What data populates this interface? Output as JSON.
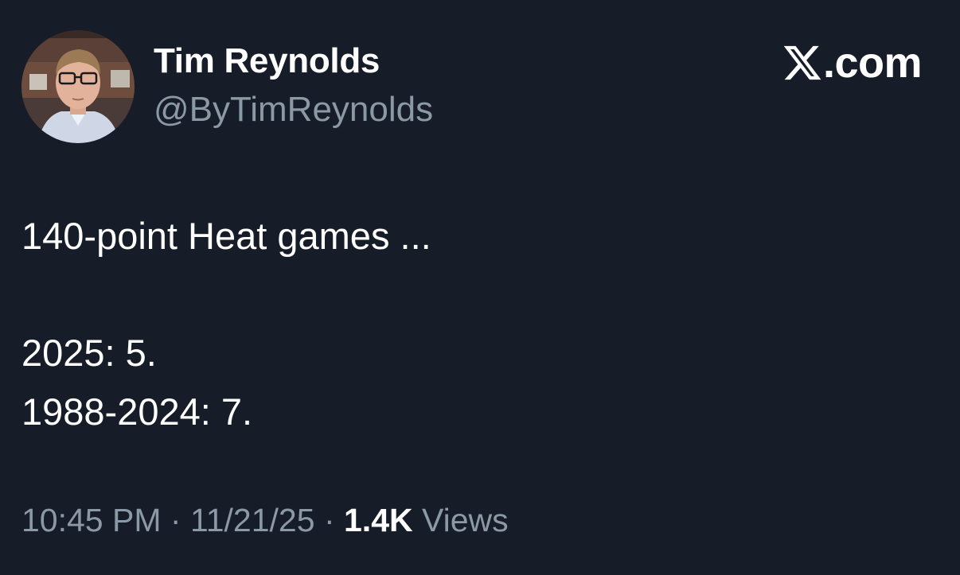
{
  "author": {
    "display_name": "Tim Reynolds",
    "handle": "@ByTimReynolds",
    "avatar_icon": "profile-photo"
  },
  "brand": {
    "logo_icon": "x-logo-icon",
    "text": ".com"
  },
  "tweet": {
    "lines": [
      "140-point Heat games ...",
      "2025: 5.",
      "1988-2024: 7."
    ]
  },
  "meta": {
    "time": "10:45 PM",
    "separator": "·",
    "date": "11/21/25",
    "views_count": "1.4K",
    "views_label": "Views"
  },
  "colors": {
    "background": "#171d28",
    "primary_text": "#ffffff",
    "secondary_text": "#8b98a5"
  }
}
